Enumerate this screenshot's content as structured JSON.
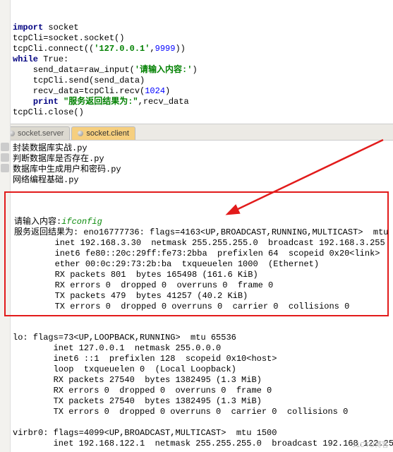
{
  "code": {
    "l1_kw": "import",
    "l1_rest": " socket",
    "l2": "tcpCli=socket.socket()",
    "l3a": "tcpCli.connect((",
    "l3_str": "'127.0.0.1'",
    "l3b": ",",
    "l3_num": "9999",
    "l3c": "))",
    "l4a": "while",
    "l4b": " True:",
    "l5a": "    send_data=raw_input(",
    "l5_str": "'请输入内容:'",
    "l5b": ")",
    "l6": "    tcpCli.send(send_data)",
    "l7a": "    recv_data=tcpCli.recv(",
    "l7_num": "1024",
    "l7b": ")",
    "l8a": "    ",
    "l8_kw": "print",
    "l8b": " ",
    "l8_str": "\"服务返回结果为:\"",
    "l8c": ",recv_data",
    "l9": "tcpCli.close()"
  },
  "tabs": {
    "server": "socket.server",
    "client": "socket.client"
  },
  "files": [
    "封装数据库实战.py",
    "判断数据库是否存在.py",
    "数据库中生成用户和密码.py",
    "网络编程基础.py"
  ],
  "hl": {
    "prompt": "请输入内容:",
    "cmd": "ifconfig",
    "result_label": "服务返回结果为: ",
    "lines": [
      "eno16777736: flags=4163<UP,BROADCAST,RUNNING,MULTICAST>  mtu",
      "        inet 192.168.3.30  netmask 255.255.255.0  broadcast 192.168.3.255",
      "        inet6 fe80::20c:29ff:fe73:2bba  prefixlen 64  scopeid 0x20<link>",
      "        ether 00:0c:29:73:2b:ba  txqueuelen 1000  (Ethernet)",
      "        RX packets 801  bytes 165498 (161.6 KiB)",
      "        RX errors 0  dropped 0  overruns 0  frame 0",
      "        TX packets 479  bytes 41257 (40.2 KiB)",
      "        TX errors 0  dropped 0 overruns 0  carrier 0  collisions 0"
    ]
  },
  "out2": [
    "lo: flags=73<UP,LOOPBACK,RUNNING>  mtu 65536",
    "        inet 127.0.0.1  netmask 255.0.0.0",
    "        inet6 ::1  prefixlen 128  scopeid 0x10<host>",
    "        loop  txqueuelen 0  (Local Loopback)",
    "        RX packets 27540  bytes 1382495 (1.3 MiB)",
    "        RX errors 0  dropped 0  overruns 0  frame 0",
    "        TX packets 27540  bytes 1382495 (1.3 MiB)",
    "        TX errors 0  dropped 0 overruns 0  carrier 0  collisions 0",
    "",
    "virbr0: flags=4099<UP,BROADCAST,MULTICAST>  mtu 1500",
    "        inet 192.168.122.1  netmask 255.255.255.0  broadcast 192.168.122.25"
  ],
  "watermark": "51CTO博客",
  "colors": {
    "highlight_border": "#e21b1b",
    "arrow": "#e21b1b",
    "cmd_green": "#0a8a0a"
  }
}
